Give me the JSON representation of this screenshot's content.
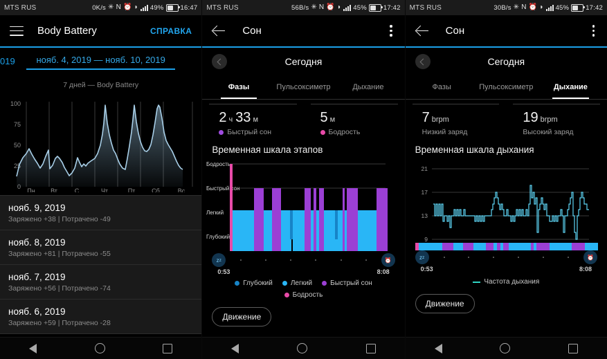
{
  "panel1": {
    "status": {
      "carrier": "MTS RUS",
      "net_speed": "0K/s",
      "battery_pct": "49%",
      "time": "16:47",
      "icons": [
        "bluetooth-icon",
        "nfc-icon",
        "alarm-icon",
        "wifi-icon",
        "signal-icon",
        "battery-icon"
      ]
    },
    "appbar": {
      "title": "Body Battery",
      "action": "СПРАВКА",
      "menu_icon": "hamburger-icon"
    },
    "date_prev_partial": "019",
    "date_current": "нояб. 4, 2019 — нояб. 10, 2019",
    "subtitle": "7 дней — Body Battery",
    "list_header_note": "",
    "list": [
      {
        "date": "нояб. 9, 2019",
        "detail": "Заряжено +38 | Потрачено -49"
      },
      {
        "date": "нояб. 8, 2019",
        "detail": "Заряжено +81 | Потрачено -55"
      },
      {
        "date": "нояб. 7, 2019",
        "detail": "Заряжено +56 | Потрачено -74"
      },
      {
        "date": "нояб. 6, 2019",
        "detail": "Заряжено +59 | Потрачено -28"
      }
    ]
  },
  "panel2": {
    "status": {
      "carrier": "MTS RUS",
      "net_speed": "56B/s",
      "battery_pct": "45%",
      "time": "17:42"
    },
    "appbar": {
      "title": "Сон",
      "back_icon": "back-arrow-icon",
      "menu_icon": "kebab-menu-icon"
    },
    "day_label": "Сегодня",
    "tabs": [
      {
        "label": "Фазы",
        "active": true
      },
      {
        "label": "Пульсоксиметр",
        "active": false
      },
      {
        "label": "Дыхание",
        "active": false
      }
    ],
    "stats": [
      {
        "value": "2",
        "unit": "ч",
        "value2": "33",
        "unit2": "м",
        "label": "Быстрый сон",
        "color": "#a04ce0"
      },
      {
        "value": "5",
        "unit": "м",
        "value2": "",
        "unit2": "",
        "label": "Бодрость",
        "color": "#e84aa8"
      }
    ],
    "section_title": "Временная шкала этапов",
    "time_start": "0:53",
    "time_end": "8:08",
    "legend": [
      {
        "label": "Глубокий",
        "color": "#1784c7"
      },
      {
        "label": "Легкий",
        "color": "#29b6f6"
      },
      {
        "label": "Быстрый сон",
        "color": "#9b3fd4"
      },
      {
        "label": "Бодрость",
        "color": "#e84aa8"
      }
    ],
    "button": "Движение",
    "start_icon": "sleep-zzz-icon",
    "end_icon": "alarm-clock-icon"
  },
  "panel3": {
    "status": {
      "carrier": "MTS RUS",
      "net_speed": "30B/s",
      "battery_pct": "45%",
      "time": "17:42"
    },
    "appbar": {
      "title": "Сон",
      "back_icon": "back-arrow-icon",
      "menu_icon": "kebab-menu-icon"
    },
    "day_label": "Сегодня",
    "tabs": [
      {
        "label": "Фазы",
        "active": false
      },
      {
        "label": "Пульсоксиметр",
        "active": false
      },
      {
        "label": "Дыхание",
        "active": true
      }
    ],
    "stats": [
      {
        "value": "7",
        "unit": "brpm",
        "label": "Низкий заряд"
      },
      {
        "value": "19",
        "unit": "brpm",
        "label": "Высокий заряд"
      }
    ],
    "section_title": "Временная шкала дыхания",
    "time_start": "0:53",
    "time_end": "8:08",
    "legend": [
      {
        "label": "Частота дыхания",
        "color": "#2fd4c4",
        "type": "line"
      }
    ],
    "button": "Движение",
    "start_icon": "sleep-zzz-icon",
    "end_icon": "alarm-clock-icon"
  },
  "navbar": {
    "back": "nav-back-icon",
    "home": "nav-home-icon",
    "recents": "nav-recents-icon"
  },
  "chart_data": [
    {
      "type": "area",
      "title": "Body Battery 7 дней",
      "xlabel": "",
      "ylabel": "",
      "categories": [
        "Пн",
        "Вт",
        "С",
        "Чт",
        "Пт",
        "Сб",
        "Вс"
      ],
      "yticks": [
        0,
        25,
        50,
        75,
        100
      ],
      "ylim": [
        0,
        100
      ],
      "line_color": "#9fc9e8",
      "values": [
        12,
        30,
        52,
        67,
        58,
        50,
        43,
        34,
        47,
        70,
        86,
        65,
        57,
        55,
        44,
        36,
        27,
        33,
        43,
        61,
        54,
        47,
        52,
        49,
        53,
        55,
        61,
        68,
        100,
        75,
        64,
        62,
        56,
        48,
        40,
        38,
        54,
        74,
        100,
        73,
        63,
        57,
        54,
        53,
        58,
        72,
        100,
        88,
        70,
        64,
        58,
        55
      ],
      "grid": true
    },
    {
      "type": "bar",
      "title": "Временная шкала этапов",
      "subtype": "hypnogram",
      "stages": [
        "Глубокий",
        "Легкий",
        "Быстрый сон",
        "Бодрость"
      ],
      "stage_colors": {
        "Глубокий": "#1784c7",
        "Легкий": "#29b6f6",
        "Быстрый сон": "#9b3fd4",
        "Бодрость": "#e84aa8"
      },
      "xrange": [
        "0:53",
        "8:08"
      ],
      "segments": [
        {
          "start": 0,
          "width": 1.5,
          "stage": "Бодрость"
        },
        {
          "start": 1.5,
          "width": 14,
          "stage": "Легкий"
        },
        {
          "start": 15.5,
          "width": 3,
          "stage": "Быстрый сон"
        },
        {
          "start": 18.5,
          "width": 5.5,
          "stage": "Быстрый сон"
        },
        {
          "start": 24,
          "width": 6,
          "stage": "Легкий"
        },
        {
          "start": 30,
          "width": 1.5,
          "stage": "Глубокий"
        },
        {
          "start": 31.5,
          "width": 6,
          "stage": "Легкий"
        },
        {
          "start": 37.5,
          "width": 3,
          "stage": "Быстрый сон"
        },
        {
          "start": 41,
          "width": 1.5,
          "stage": "Легкий"
        },
        {
          "start": 42.5,
          "width": 2,
          "stage": "Быстрый сон"
        },
        {
          "start": 45,
          "width": 1.5,
          "stage": "Быстрый сон"
        },
        {
          "start": 47,
          "width": 10,
          "stage": "Легкий"
        },
        {
          "start": 57,
          "width": 1.5,
          "stage": "Глубокий"
        },
        {
          "start": 58.5,
          "width": 8,
          "stage": "Легкий"
        },
        {
          "start": 67,
          "width": 1,
          "stage": "Быстрый сон"
        },
        {
          "start": 68.5,
          "width": 6,
          "stage": "Быстрый сон"
        },
        {
          "start": 75,
          "width": 7,
          "stage": "Легкий"
        },
        {
          "start": 82,
          "width": 8,
          "stage": "Быстрый сон"
        }
      ]
    },
    {
      "type": "line",
      "title": "Временная шкала дыхания",
      "ylabel": "brpm",
      "yticks": [
        9,
        13,
        17,
        21
      ],
      "ylim": [
        8,
        22
      ],
      "line_color": "#5ed5f5",
      "xrange": [
        "0:53",
        "8:08"
      ],
      "legend": "Частота дыхания",
      "values": [
        15,
        15,
        14,
        15,
        14,
        15,
        14,
        15,
        13,
        13,
        13,
        13,
        13,
        13,
        12,
        11,
        13,
        13,
        14,
        13,
        14,
        14,
        13,
        13,
        13,
        13,
        13,
        13,
        13,
        13,
        12,
        13,
        12,
        13,
        12,
        13,
        13,
        13,
        13,
        14,
        15,
        16,
        17,
        16,
        15,
        14,
        15,
        14,
        13,
        14,
        13,
        14,
        13,
        13,
        14,
        14,
        13,
        14,
        13,
        13,
        14,
        15,
        14,
        13,
        18,
        15,
        16,
        14,
        10,
        15,
        16,
        15,
        14,
        14,
        13,
        12,
        13,
        12,
        13,
        13,
        12,
        14,
        14,
        13,
        13,
        10,
        14,
        15,
        16,
        13,
        9,
        12,
        13,
        14,
        16,
        16,
        15,
        15,
        14,
        14
      ]
    }
  ]
}
